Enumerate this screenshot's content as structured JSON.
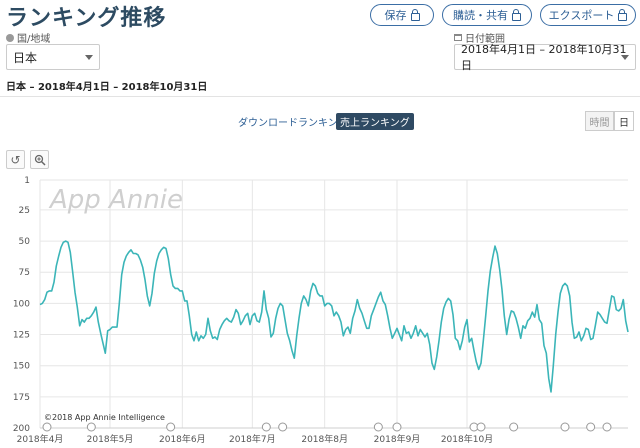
{
  "header": {
    "title": "ランキング推移"
  },
  "actions": {
    "save": "保存",
    "subscribe": "購読・共有",
    "export": "エクスポート"
  },
  "filters": {
    "country_label": "国/地域",
    "country_value": "日本",
    "date_label": "日付範囲",
    "date_value": "2018年4月1日 – 2018年10月31日"
  },
  "summary": {
    "period": "日本 – 2018年4月1日 – 2018年10月31日"
  },
  "tabs": {
    "downloads": "ダウンロードランキング",
    "revenue": "売上ランキング"
  },
  "granularity": {
    "hourly": "時間",
    "daily": "日"
  },
  "tool_icons": [
    "reset-icon",
    "zoom-icon"
  ],
  "colors": {
    "line": "#3bb5b8",
    "title": "#2d4b62",
    "accent": "#2f4a63"
  },
  "chart_data": {
    "type": "line",
    "watermark": "App Annie",
    "credit": "©2018 App Annie Intelligence",
    "y_reversed": true,
    "ylim": [
      1,
      200
    ],
    "yticks": [
      "1",
      "25",
      "50",
      "75",
      "100",
      "125",
      "150",
      "175",
      "200"
    ],
    "xlabels": [
      "2018年4月",
      "2018年5月",
      "2018年6月",
      "2018年7月",
      "2018年8月",
      "2018年9月",
      "2018年10月"
    ],
    "grid": true,
    "series": [
      {
        "values": [
          101,
          100,
          97,
          91,
          90,
          90,
          83,
          70,
          62,
          55,
          51,
          50,
          51,
          59,
          75,
          91,
          103,
          118,
          113,
          115,
          112,
          112,
          110,
          107,
          103,
          115,
          124,
          132,
          140,
          122,
          121,
          119,
          119,
          119,
          100,
          77,
          67,
          62,
          59,
          57,
          60,
          60,
          61,
          65,
          71,
          81,
          94,
          102,
          92,
          76,
          66,
          60,
          57,
          55,
          56,
          64,
          77,
          86,
          88,
          88,
          90,
          90,
          98,
          98,
          110,
          125,
          130,
          123,
          130,
          126,
          128,
          125,
          112,
          122,
          128,
          127,
          129,
          121,
          117,
          114,
          112,
          114,
          115,
          111,
          105,
          108,
          117,
          114,
          110,
          108,
          117,
          110,
          108,
          114,
          115,
          107,
          90,
          105,
          112,
          127,
          124,
          112,
          104,
          100,
          102,
          113,
          124,
          130,
          138,
          144,
          126,
          112,
          100,
          94,
          97,
          102,
          90,
          84,
          86,
          92,
          94,
          94,
          102,
          100,
          100,
          102,
          110,
          107,
          110,
          115,
          126,
          121,
          119,
          124,
          112,
          106,
          97,
          104,
          108,
          114,
          120,
          120,
          110,
          105,
          100,
          95,
          91,
          98,
          101,
          110,
          120,
          128,
          124,
          120,
          125,
          130,
          118,
          124,
          123,
          128,
          124,
          118,
          126,
          121,
          124,
          127,
          124,
          133,
          148,
          153,
          143,
          130,
          115,
          104,
          99,
          96,
          98,
          109,
          128,
          130,
          137,
          130,
          119,
          113,
          131,
          128,
          138,
          147,
          153,
          148,
          130,
          110,
          90,
          74,
          63,
          54,
          60,
          73,
          89,
          110,
          125,
          113,
          106,
          107,
          112,
          119,
          128,
          118,
          120,
          114,
          112,
          107,
          111,
          101,
          113,
          116,
          134,
          140,
          160,
          171,
          150,
          125,
          107,
          92,
          86,
          84,
          86,
          94,
          115,
          128,
          127,
          123,
          130,
          126,
          120,
          121,
          129,
          128,
          118,
          107,
          109,
          112,
          115,
          116,
          105,
          94,
          95,
          105,
          106,
          104,
          97,
          114,
          123
        ]
      }
    ]
  }
}
